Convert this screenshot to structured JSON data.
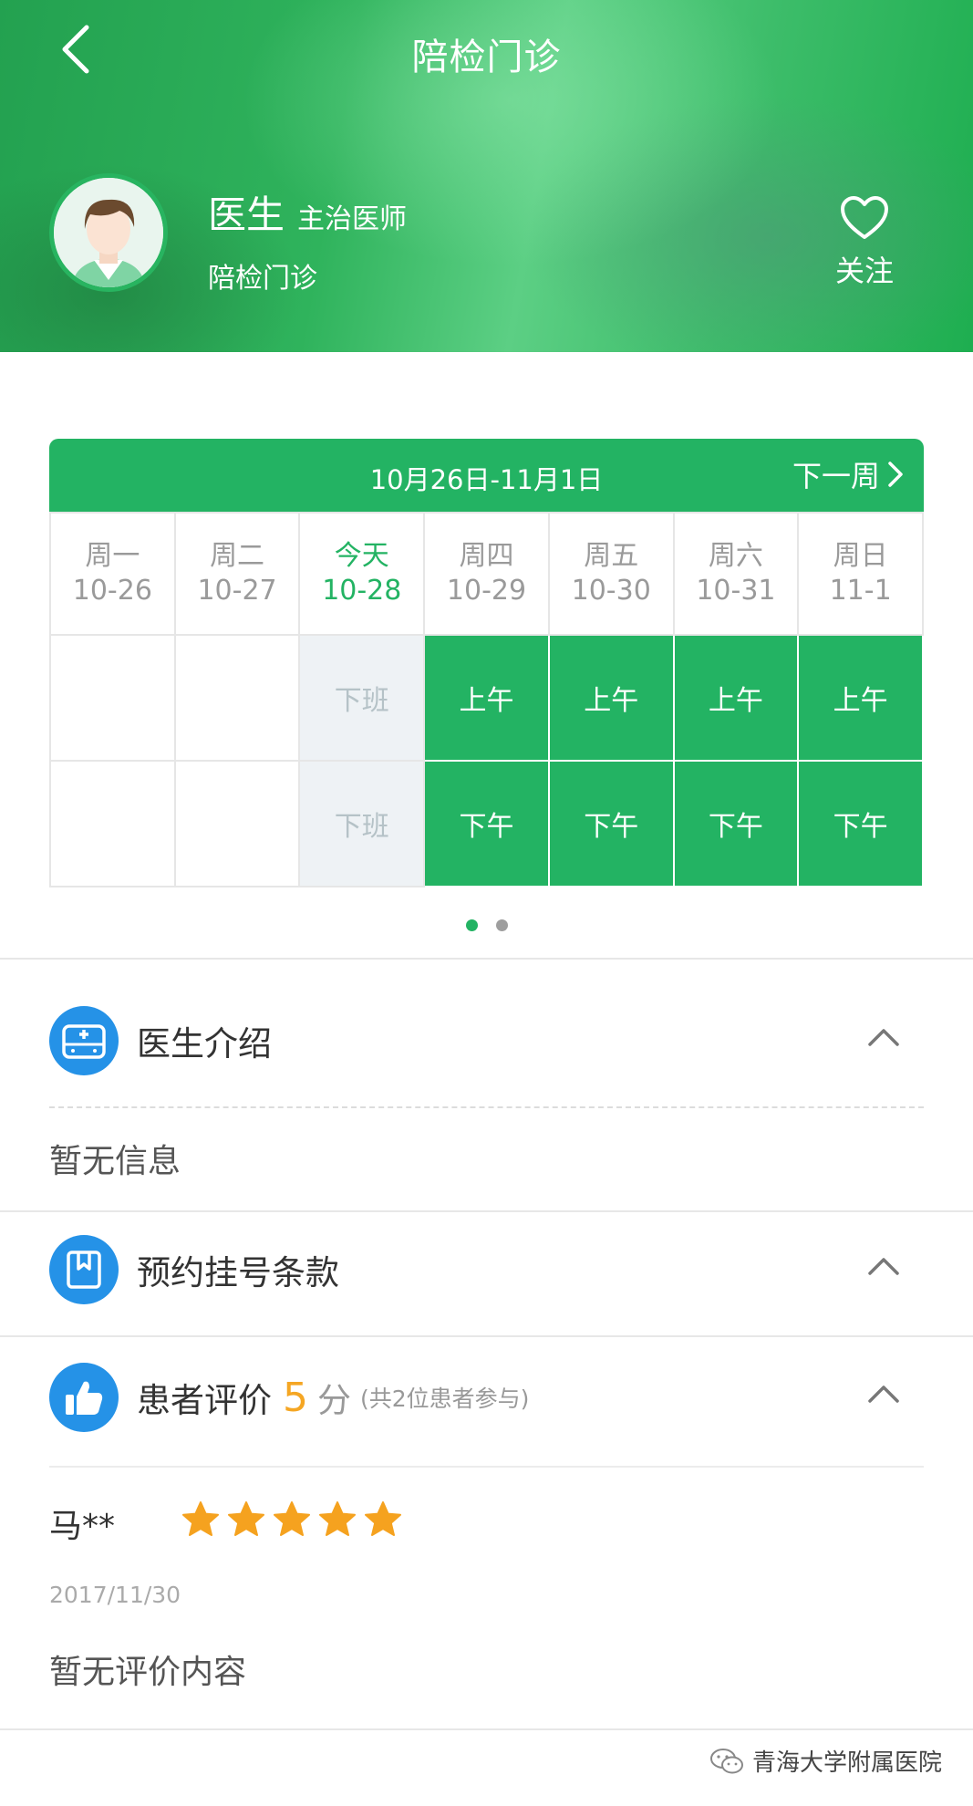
{
  "header": {
    "title": "陪检门诊",
    "doctor": {
      "name": "医生",
      "title": "主治医师",
      "department": "陪检门诊"
    },
    "follow_label": "关注"
  },
  "schedule": {
    "date_range": "10月26日-11月1日",
    "next_week_label": "下一周",
    "days": [
      {
        "weekday": "周一",
        "date": "10-26",
        "today": false
      },
      {
        "weekday": "周二",
        "date": "10-27",
        "today": false
      },
      {
        "weekday": "今天",
        "date": "10-28",
        "today": true
      },
      {
        "weekday": "周四",
        "date": "10-29",
        "today": false
      },
      {
        "weekday": "周五",
        "date": "10-30",
        "today": false
      },
      {
        "weekday": "周六",
        "date": "10-31",
        "today": false
      },
      {
        "weekday": "周日",
        "date": "11-1",
        "today": false
      }
    ],
    "morning": [
      "",
      "",
      "下班",
      "上午",
      "上午",
      "上午",
      "上午"
    ],
    "afternoon": [
      "",
      "",
      "下班",
      "下午",
      "下午",
      "下午",
      "下午"
    ],
    "page_dots": 2,
    "active_dot": 0
  },
  "intro": {
    "title": "医生介绍",
    "content": "暂无信息"
  },
  "terms": {
    "title": "预约挂号条款"
  },
  "reviews": {
    "title": "患者评价",
    "score": "5",
    "score_unit": "分",
    "note": "(共2位患者参与)",
    "items": [
      {
        "user": "马**",
        "stars": 5,
        "date": "2017/11/30",
        "content": "暂无评价内容"
      }
    ]
  },
  "watermark": "青海大学附属医院",
  "colors": {
    "brand_green": "#23b363",
    "icon_blue": "#2592e7",
    "score_orange": "#f5a623",
    "star": "#f5a21f"
  }
}
